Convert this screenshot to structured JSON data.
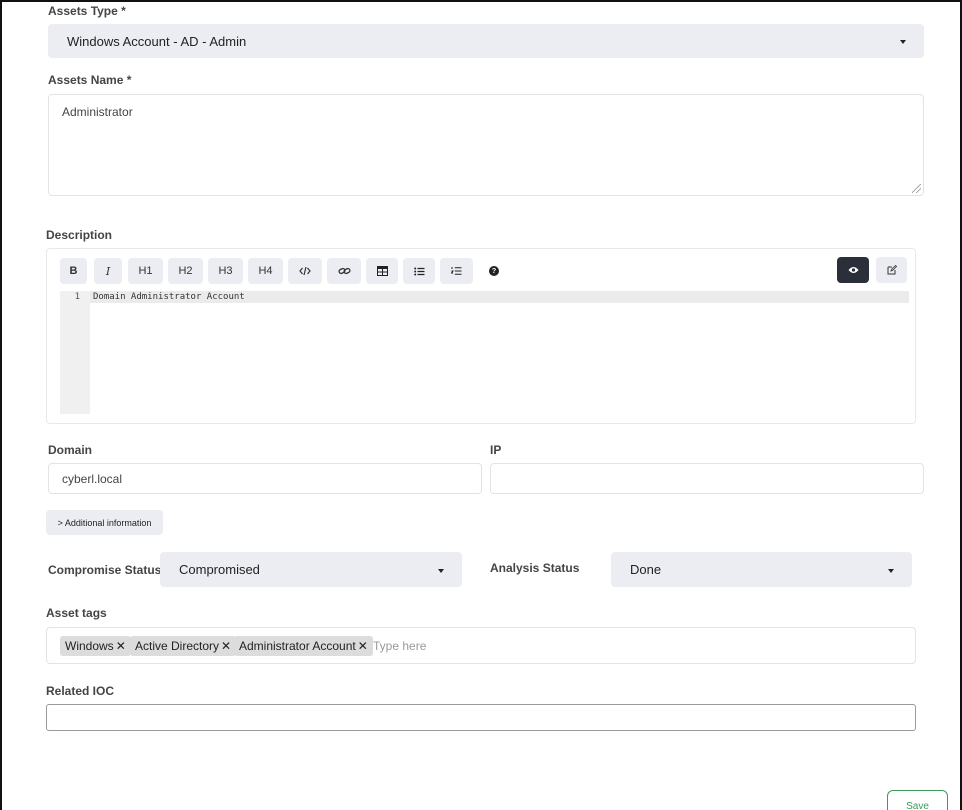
{
  "assets_type": {
    "label": "Assets Type *",
    "value": "Windows Account - AD - Admin"
  },
  "assets_name": {
    "label": "Assets Name *",
    "value": "Administrator"
  },
  "description": {
    "label": "Description",
    "toolbar": [
      "B",
      "I",
      "H1",
      "H2",
      "H3",
      "H4",
      "code",
      "link",
      "table",
      "bulleted-list",
      "numbered-list",
      "help"
    ],
    "toolbar_labels": {
      "h1": "H1",
      "h2": "H2",
      "h3": "H3",
      "h4": "H4",
      "bold": "B",
      "italic": "I"
    },
    "line_number": "1",
    "content": "Domain Administrator Account"
  },
  "domain": {
    "label": "Domain",
    "value": "cyberl.local"
  },
  "ip": {
    "label": "IP",
    "value": ""
  },
  "additional_info": {
    "label": "> Additional information"
  },
  "compromise_status": {
    "label": "Compromise Status",
    "value": "Compromised"
  },
  "analysis_status": {
    "label": "Analysis Status",
    "value": "Done"
  },
  "asset_tags": {
    "label": "Asset tags",
    "tags": [
      "Windows",
      "Active Directory",
      "Administrator Account"
    ],
    "remove_glyph": "✕",
    "placeholder": "Type here"
  },
  "related_ioc": {
    "label": "Related IOC",
    "value": ""
  },
  "save_button": {
    "label": "Save"
  },
  "colors": {
    "select_bg": "#ebedf2",
    "dark_button": "#2a2f3a",
    "save_border": "#3a9a5b",
    "tag_bg": "#dcdcdc"
  }
}
